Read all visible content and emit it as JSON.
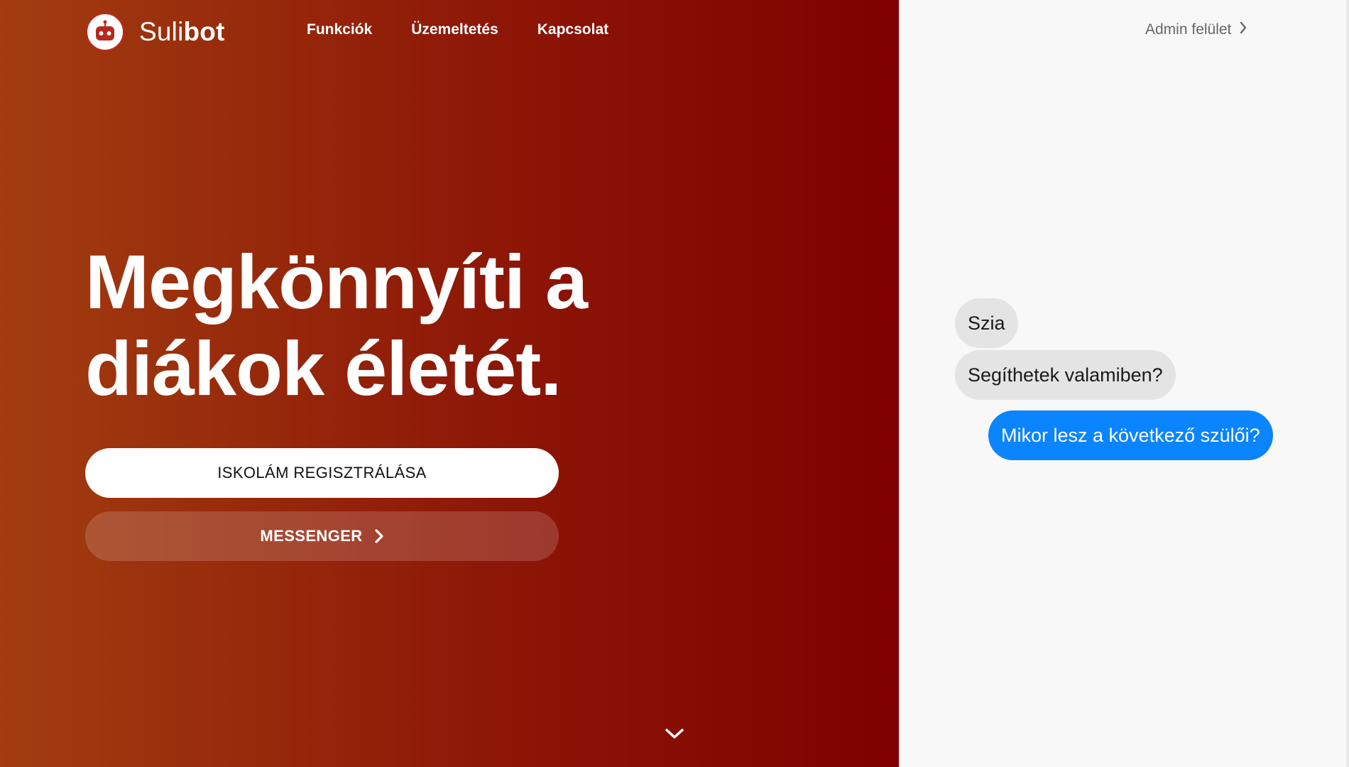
{
  "brand": {
    "name_light": "Suli",
    "name_bold": "bot"
  },
  "nav": {
    "items": [
      {
        "label": "Funkciók"
      },
      {
        "label": "Üzemeltetés"
      },
      {
        "label": "Kapcsolat"
      }
    ]
  },
  "hero": {
    "headline_line1": "Megkönnyíti a",
    "headline_line2": "diákok életét.",
    "register_label": "ISKOLÁM REGISZTRÁLÁSA",
    "messenger_label": "MESSENGER"
  },
  "side": {
    "admin_label": "Admin felület"
  },
  "chat": {
    "messages": [
      {
        "from": "bot",
        "text": "Szia"
      },
      {
        "from": "bot",
        "text": "Segíthetek valamiben?"
      },
      {
        "from": "user",
        "text": "Mikor lesz a következő szülői?"
      }
    ]
  },
  "colors": {
    "hero_start": "#a23d10",
    "hero_end": "#7f0000",
    "user_bubble": "#0a84ff",
    "bot_bubble": "#e4e4e4"
  },
  "icons": [
    "robot-logo-icon",
    "chevron-right-icon",
    "chevron-down-icon"
  ]
}
